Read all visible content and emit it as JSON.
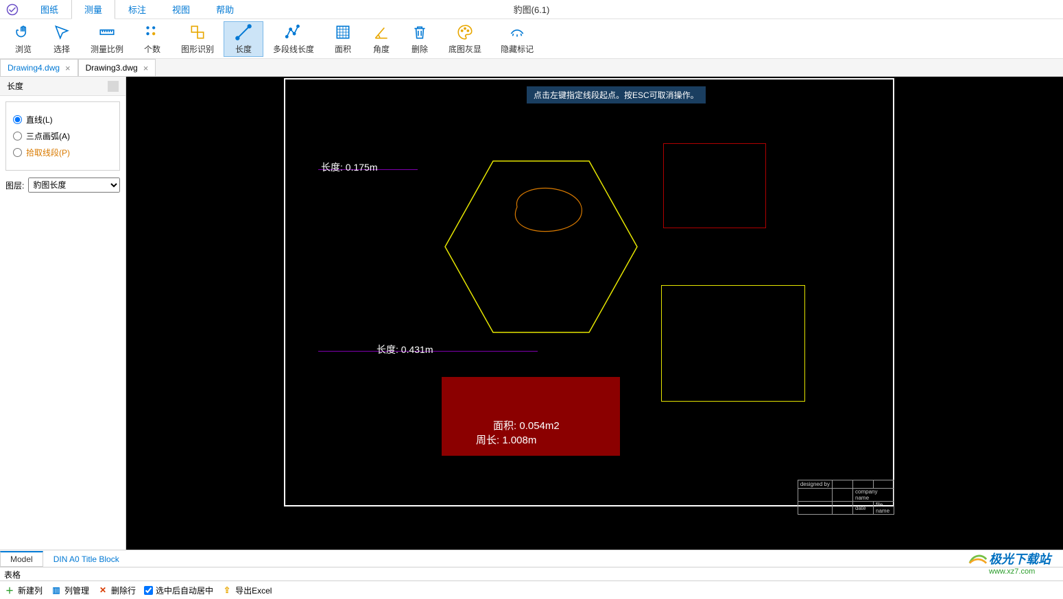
{
  "app": {
    "title": "豹图(6.1)"
  },
  "menu": {
    "items": [
      "图纸",
      "测量",
      "标注",
      "视图",
      "帮助"
    ],
    "active_index": 1
  },
  "ribbon": {
    "items": [
      {
        "label": "浏览",
        "icon": "hand"
      },
      {
        "label": "选择",
        "icon": "cursor"
      },
      {
        "label": "测量比例",
        "icon": "ruler"
      },
      {
        "label": "个数",
        "icon": "dots"
      },
      {
        "label": "图形识别",
        "icon": "shapes"
      },
      {
        "label": "长度",
        "icon": "length"
      },
      {
        "label": "多段线长度",
        "icon": "polyline"
      },
      {
        "label": "面积",
        "icon": "area"
      },
      {
        "label": "角度",
        "icon": "angle"
      },
      {
        "label": "删除",
        "icon": "trash"
      },
      {
        "label": "底图灰显",
        "icon": "palette"
      },
      {
        "label": "隐藏标记",
        "icon": "eye-hide"
      }
    ],
    "active_index": 5
  },
  "fileTabs": {
    "items": [
      "Drawing4.dwg",
      "Drawing3.dwg"
    ],
    "active_index": 0
  },
  "sidepanel": {
    "title": "长度",
    "options": {
      "line": "直线(L)",
      "arc": "三点画弧(A)",
      "pick": "拾取线段(P)"
    },
    "selected": "line",
    "layer_label": "图层:",
    "layer_value": "豹图长度"
  },
  "canvas": {
    "hint": "点击左键指定线段起点。按ESC可取消操作。",
    "meas1_text": "长度: 0.175m",
    "meas2_text": "长度: 0.431m",
    "area_line1": "面积: 0.054m2",
    "area_line2": "周长: 1.008m",
    "titleblock": {
      "designed_by": "designed by",
      "company": "company name",
      "date": "date",
      "file": "file name"
    }
  },
  "bottomTabs": {
    "items": [
      "Model",
      "DIN A0 Title Block"
    ],
    "active_index": 0
  },
  "tableHeader": "表格",
  "bottomToolbar": {
    "newCol": "新建列",
    "manageCol": "列管理",
    "delRow": "删除行",
    "autoCenter": "选中后自动居中",
    "exportExcel": "导出Excel"
  },
  "watermark": {
    "name": "极光下载站",
    "url": "www.xz7.com"
  }
}
